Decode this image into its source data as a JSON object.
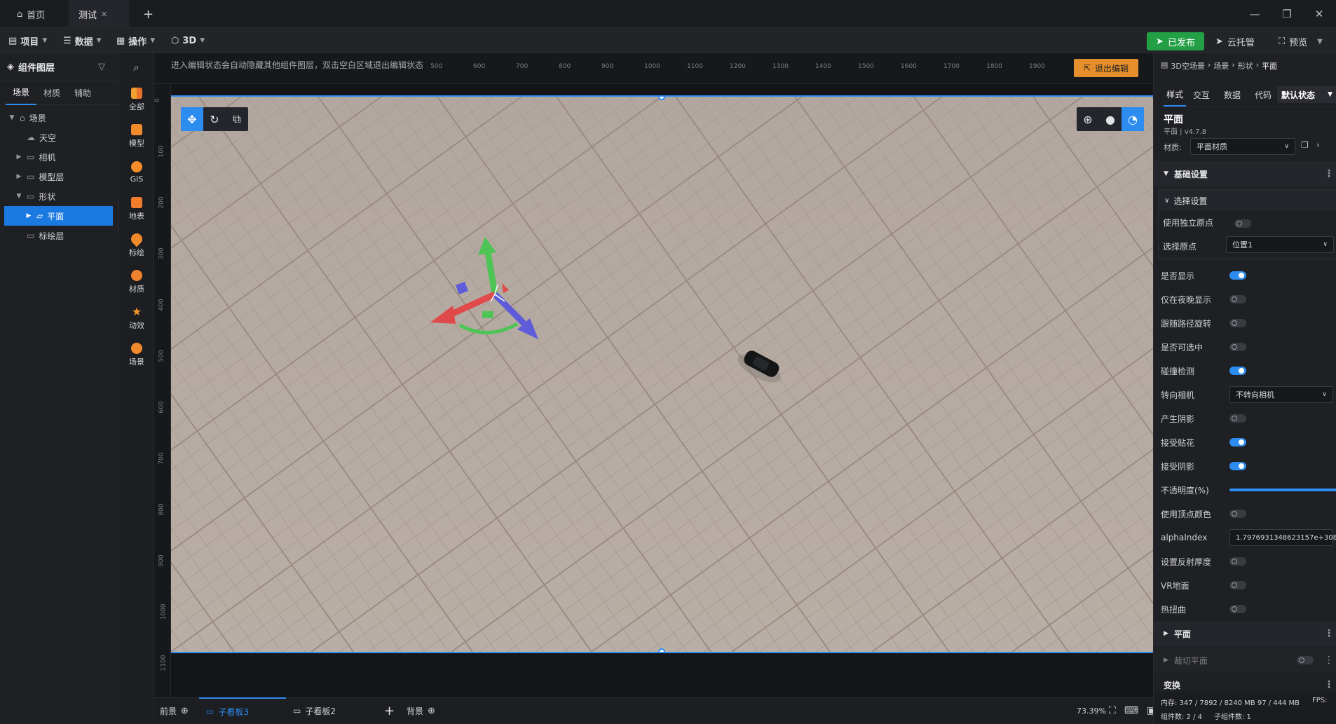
{
  "window": {
    "tabs": [
      {
        "label": "首页",
        "icon": "home-icon"
      },
      {
        "label": "测试",
        "icon": "close-icon"
      }
    ],
    "new_tab": "+",
    "controls": [
      "—",
      "❐",
      "✕"
    ]
  },
  "menubar": {
    "items": [
      "项目",
      "数据",
      "操作",
      "3D"
    ],
    "publish": "已发布",
    "cloud": "云托管",
    "preview": "预览"
  },
  "left_panel": {
    "title": "组件图层",
    "tabs": [
      "场景",
      "材质",
      "辅助"
    ],
    "tree": [
      "场景",
      "天空",
      "相机",
      "模型层",
      "形状",
      "平面",
      "标绘层"
    ]
  },
  "categories": [
    "全部",
    "模型",
    "GIS",
    "地表",
    "标绘",
    "材质",
    "动效",
    "场景"
  ],
  "canvas": {
    "hint": "进入编辑状态会自动隐藏其他组件图层，双击空白区域退出编辑状态",
    "exit_edit": "退出编辑",
    "ruler_top": [
      "500",
      "600",
      "700",
      "800",
      "900",
      "1000",
      "1100",
      "1200",
      "1300",
      "1400",
      "1500",
      "1600",
      "1700",
      "1800",
      "1900"
    ],
    "ruler_left": [
      "0",
      "100",
      "200",
      "300",
      "400",
      "500",
      "600",
      "700",
      "800",
      "900",
      "1000",
      "1100"
    ]
  },
  "bottom_bar": {
    "front": "前景",
    "boards": [
      "子看板3",
      "子看板2"
    ],
    "add": "+",
    "back": "背景",
    "zoom": "73.39%"
  },
  "right_panel": {
    "breadcrumb": [
      "3D空场景",
      "场景",
      "形状",
      "平面"
    ],
    "tabs": [
      "样式",
      "交互",
      "数据",
      "代码"
    ],
    "state": "默认状态",
    "title": "平面",
    "version": "平面 | v4.7.8",
    "material_label": "材质:",
    "material_value": "平面材质",
    "basic_section": "基础设置",
    "select_section": "选择设置",
    "use_origin": "使用独立原点",
    "select_origin": "选择原点",
    "select_origin_value": "位置1",
    "rows": [
      {
        "label": "是否显示",
        "on": true
      },
      {
        "label": "仅在夜晚显示",
        "on": false
      },
      {
        "label": "跟随路径旋转",
        "on": false
      },
      {
        "label": "是否可选中",
        "on": false
      },
      {
        "label": "碰撞检测",
        "on": true
      },
      {
        "label": "转向相机",
        "select": "不转向相机"
      },
      {
        "label": "产生阴影",
        "on": false
      },
      {
        "label": "接受贴花",
        "on": true
      },
      {
        "label": "接受阴影",
        "on": true
      },
      {
        "label": "不透明度(%)",
        "slider": 1.0
      },
      {
        "label": "使用顶点颜色",
        "on": false
      },
      {
        "label": "alphaIndex",
        "input": "1.7976931348623157e+308"
      },
      {
        "label": "设置反射厚度",
        "on": false
      },
      {
        "label": "VR地面",
        "on": false
      },
      {
        "label": "热扭曲",
        "on": false
      }
    ],
    "plane_section": "平面",
    "clip_section": "裁切平面",
    "transform_section": "变换",
    "status": {
      "memory": "内存:  347 / 7892 / 8240 MB  97 / 444 MB",
      "fps": "FPS:",
      "components": "组件数: 2 / 4",
      "subcomponents": "子组件数: 1"
    }
  },
  "colors": {
    "accent": "#2d8cf0",
    "publish": "#23a046",
    "exit": "#e58e2c",
    "ground": "#b7aca3"
  }
}
